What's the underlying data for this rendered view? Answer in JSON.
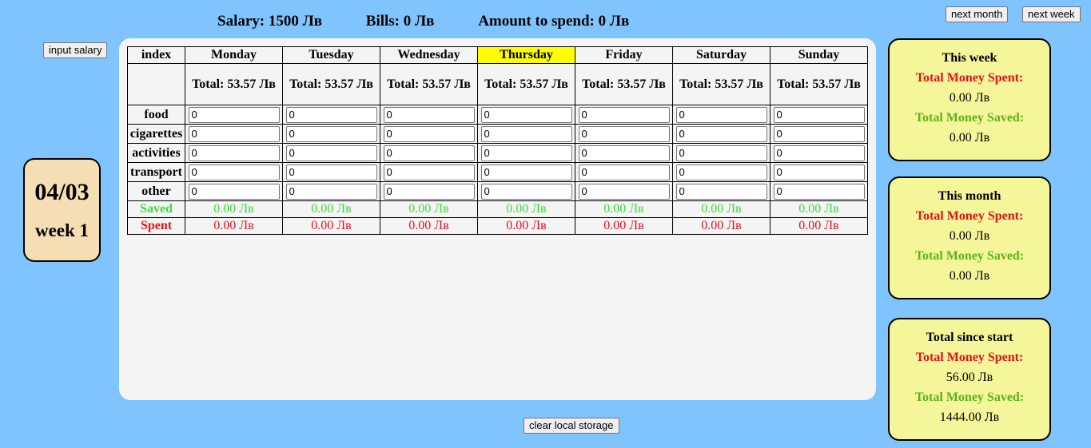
{
  "summary": {
    "salary": "Salary: 1500 Лв",
    "bills": "Bills: 0 Лв",
    "amount": "Amount to spend: 0 Лв"
  },
  "buttons": {
    "input_salary": "input salary",
    "next_month": "next month",
    "next_week": "next week",
    "clear_storage": "clear local storage"
  },
  "date_card": {
    "date": "04/03",
    "week": "week 1"
  },
  "table": {
    "index_header": "index",
    "days": [
      "Monday",
      "Tuesday",
      "Wednesday",
      "Thursday",
      "Friday",
      "Saturday",
      "Sunday"
    ],
    "today_index": 3,
    "totals": [
      "Total: 53.57 Лв",
      "Total: 53.57 Лв",
      "Total: 53.57 Лв",
      "Total: 53.57 Лв",
      "Total: 53.57 Лв",
      "Total: 53.57 Лв",
      "Total: 53.57 Лв"
    ],
    "categories": [
      {
        "label": "food",
        "values": [
          "0",
          "0",
          "0",
          "0",
          "0",
          "0",
          "0"
        ]
      },
      {
        "label": "cigarettes",
        "values": [
          "0",
          "0",
          "0",
          "0",
          "0",
          "0",
          "0"
        ]
      },
      {
        "label": "activities",
        "values": [
          "0",
          "0",
          "0",
          "0",
          "0",
          "0",
          "0"
        ]
      },
      {
        "label": "transport",
        "values": [
          "0",
          "0",
          "0",
          "0",
          "0",
          "0",
          "0"
        ]
      },
      {
        "label": "other",
        "values": [
          "0",
          "0",
          "0",
          "0",
          "0",
          "0",
          "0"
        ]
      }
    ],
    "saved_label": "Saved",
    "saved": [
      "0.00 Лв",
      "0.00 Лв",
      "0.00 Лв",
      "0.00 Лв",
      "0.00 Лв",
      "0.00 Лв",
      "0.00 Лв"
    ],
    "spent_label": "Spent",
    "spent": [
      "0.00 Лв",
      "0.00 Лв",
      "0.00 Лв",
      "0.00 Лв",
      "0.00 Лв",
      "0.00 Лв",
      "0.00 Лв"
    ]
  },
  "cards": {
    "week": {
      "title": "This week",
      "spent_label": "Total Money Spent:",
      "spent": "0.00 Лв",
      "saved_label": "Total Money Saved:",
      "saved": "0.00 Лв"
    },
    "month": {
      "title": "This month",
      "spent_label": "Total Money Spent:",
      "spent": "0.00 Лв",
      "saved_label": "Total Money Saved:",
      "saved": "0.00 Лв"
    },
    "total": {
      "title": "Total since start",
      "spent_label": "Total Money Spent:",
      "spent": "56.00 Лв",
      "saved_label": "Total Money Saved:",
      "saved": "1444.00 Лв"
    }
  },
  "colors": {
    "background": "#80c4ff",
    "panel": "#f4f4f4",
    "date_card": "#f5deb3",
    "stat_card": "#f5f59a",
    "today_highlight": "#ffff00",
    "saved": "#3adc3a",
    "spent": "#e8101a",
    "card_saved": "#5cb31a"
  }
}
